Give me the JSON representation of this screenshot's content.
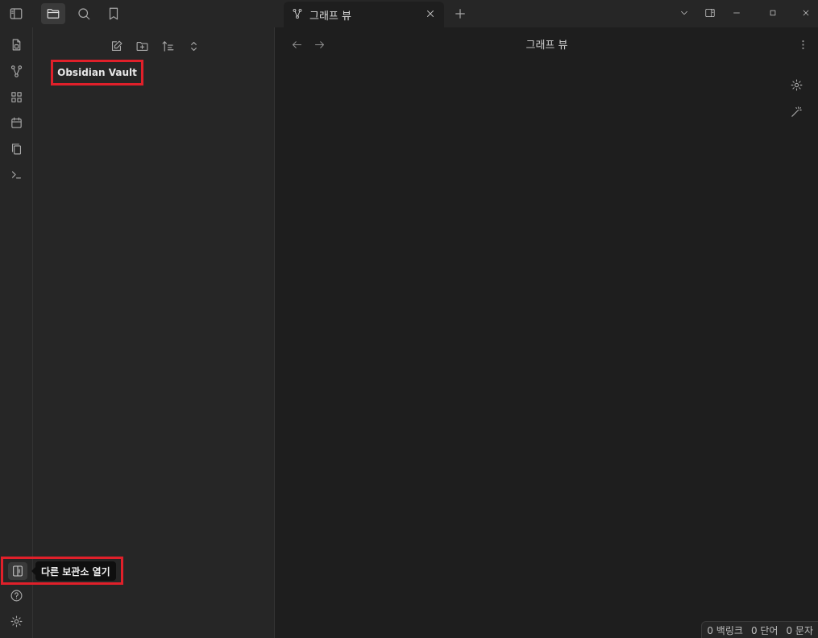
{
  "titlebar": {
    "icons": [
      "sidebar-toggle-icon",
      "folder-icon",
      "search-icon",
      "bookmark-icon"
    ],
    "tab": {
      "label": "그래프 뷰",
      "icon": "graph-icon"
    },
    "new_tab_icon": "plus-icon",
    "window_controls": [
      "chevron-down-icon",
      "right-sidebar-icon",
      "minimize-icon",
      "maximize-icon",
      "close-icon"
    ]
  },
  "ribbon": {
    "items": [
      "random-note-icon",
      "graph-icon",
      "canvas-icon",
      "calendar-icon",
      "copy-icon",
      "terminal-icon"
    ],
    "bottom": {
      "vault_switch_tooltip": "다른 보관소 열기",
      "help_icon": "help-icon",
      "settings_icon": "settings-icon"
    }
  },
  "sidebar": {
    "toolbar": [
      "new-note-icon",
      "new-folder-icon",
      "sort-icon",
      "collapse-icon"
    ],
    "vault_name": "Obsidian Vault"
  },
  "main": {
    "title": "그래프 뷰",
    "graph_controls": [
      "settings-icon",
      "wand-icon"
    ]
  },
  "status_bar": {
    "backlinks": "0 백링크",
    "words": "0 단어",
    "chars": "0 문자"
  },
  "colors": {
    "highlight": "#e0202a",
    "background": "#1e1e1e",
    "panel": "#262626"
  }
}
